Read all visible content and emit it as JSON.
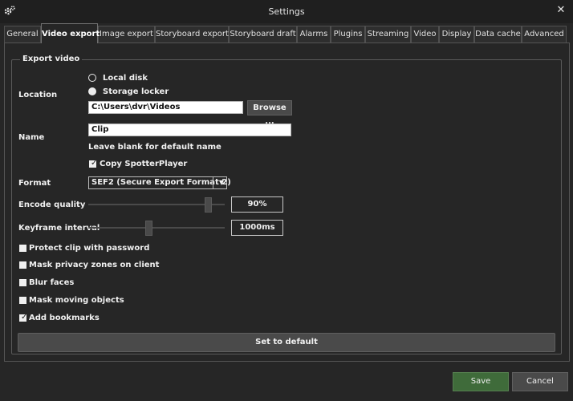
{
  "window": {
    "title": "Settings"
  },
  "tabs": [
    {
      "label": "General"
    },
    {
      "label": "Video export"
    },
    {
      "label": "Image export"
    },
    {
      "label": "Storyboard export"
    },
    {
      "label": "Storyboard draft"
    },
    {
      "label": "Alarms"
    },
    {
      "label": "Plugins"
    },
    {
      "label": "Streaming"
    },
    {
      "label": "Video"
    },
    {
      "label": "Display"
    },
    {
      "label": "Data cache"
    },
    {
      "label": "Advanced"
    }
  ],
  "active_tab": "Video export",
  "group": {
    "title": "Export video",
    "location": {
      "label": "Location",
      "options": [
        "Local disk",
        "Storage locker"
      ],
      "selected": "Storage locker",
      "path": "C:\\Users\\dvr\\Videos",
      "browse_label": "Browse ..."
    },
    "name": {
      "label": "Name",
      "value": "Clip",
      "hint": "Leave blank for default name"
    },
    "copy_player": {
      "label": "Copy SpotterPlayer",
      "checked": true
    },
    "format": {
      "label": "Format",
      "value": "SEF2 (Secure Export Format 2)"
    },
    "encode_quality": {
      "label": "Encode quality",
      "value": "90%",
      "level": 0.9
    },
    "keyframe_interval": {
      "label": "Keyframe interval",
      "value": "1000ms",
      "level": 0.44
    },
    "checkboxes": [
      {
        "label": "Protect clip with password",
        "checked": false
      },
      {
        "label": "Mask privacy zones on client",
        "checked": false
      },
      {
        "label": "Blur faces",
        "checked": false
      },
      {
        "label": "Mask moving objects",
        "checked": false
      },
      {
        "label": "Add bookmarks",
        "checked": true
      }
    ],
    "default_label": "Set to default"
  },
  "footer": {
    "save_label": "Save",
    "cancel_label": "Cancel"
  },
  "colors": {
    "save": "#3f6b3a",
    "background": "#262626",
    "titlebar": "#1f1f1f"
  }
}
